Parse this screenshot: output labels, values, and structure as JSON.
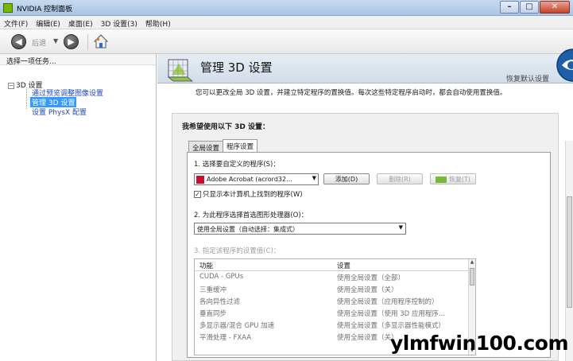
{
  "window": {
    "title": "NVIDIA 控制面板",
    "min_glyph": "–",
    "max_glyph": "□",
    "close_glyph": "✕"
  },
  "menu": [
    "文件(F)",
    "编辑(E)",
    "桌面(E)",
    "3D 设置(3)",
    "帮助(H)"
  ],
  "toolbar": {
    "back_label": "后退",
    "back_glyph": "◀",
    "forward_glyph": "▶",
    "drop_glyph": "▼"
  },
  "left": {
    "header": "选择一项任务...",
    "root": "3D 设置",
    "root_toggle": "−",
    "items": [
      "通过预览调整图像设置",
      "管理 3D 设置",
      "设置 PhysX 配置"
    ],
    "selected_index": 1
  },
  "page": {
    "title": "管理 3D 设置",
    "restore_defaults": "恢复默认设置",
    "intro": "您可以更改全局 3D 设置，并建立特定程序的置换值。每次这些特定程序启动时，都会自动使用置换值。",
    "heading": "我希望使用以下 3D 设置：",
    "tabs": [
      "全局设置",
      "程序设置"
    ],
    "active_tab": 1,
    "step1": "1. 选择要自定义的程序(S)：",
    "program_value": "Adobe Acrobat (acrord32...",
    "add_button": "添加(D)",
    "remove_button": "删除(R)",
    "restore_button": "恢复(T)",
    "only_found_label": "只显示本计算机上找到的程序(W)",
    "only_found_checked": true,
    "check_glyph": "✓",
    "step2": "2. 为此程序选择首选图形处理器(O)：",
    "gpu_value": "使用全局设置（自动选择：集成式）",
    "step3": "3. 指定该程序的设置值(C)：",
    "table": {
      "col_feature": "功能",
      "col_setting": "设置",
      "rows": [
        {
          "feature": "CUDA - GPUs",
          "setting": "使用全局设置（全部）"
        },
        {
          "feature": "三重缓冲",
          "setting": "使用全局设置（关）"
        },
        {
          "feature": "各向异性过滤",
          "setting": "使用全局设置（应用程序控制的）"
        },
        {
          "feature": "垂直同步",
          "setting": "使用全局设置（使用 3D 应用程序..."
        },
        {
          "feature": "多显示器/混合 GPU 加速",
          "setting": "使用全局设置（多显示器性能模式）"
        },
        {
          "feature": "平滑处理 - FXAA",
          "setting": "使用全局设置（关）"
        }
      ]
    },
    "dropdown_glyph": "▼",
    "scroll_up_glyph": "▲",
    "scroll_down_glyph": "▼"
  },
  "watermark": "ylmfwin100.com",
  "colors": {
    "nvidia_green": "#76b900",
    "selection_blue": "#3399ff",
    "link_blue": "#1d47b5"
  }
}
